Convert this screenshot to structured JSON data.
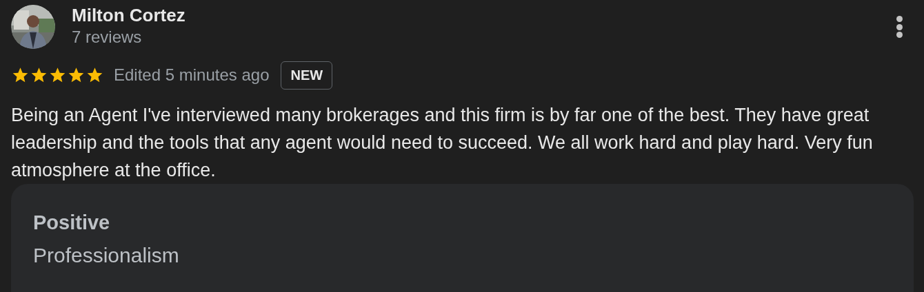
{
  "review": {
    "author": "Milton Cortez",
    "review_count": "7 reviews",
    "stars": 5,
    "edited": "Edited 5 minutes ago",
    "badge": "NEW",
    "text": "Being an Agent I've interviewed many brokerages and this firm is by far one of the best. They have great leadership and the tools that any agent would need to succeed. We all work hard and play hard. Very fun atmosphere at the office.",
    "highlights": [
      {
        "label": "Positive",
        "value": "Professionalism"
      }
    ]
  }
}
